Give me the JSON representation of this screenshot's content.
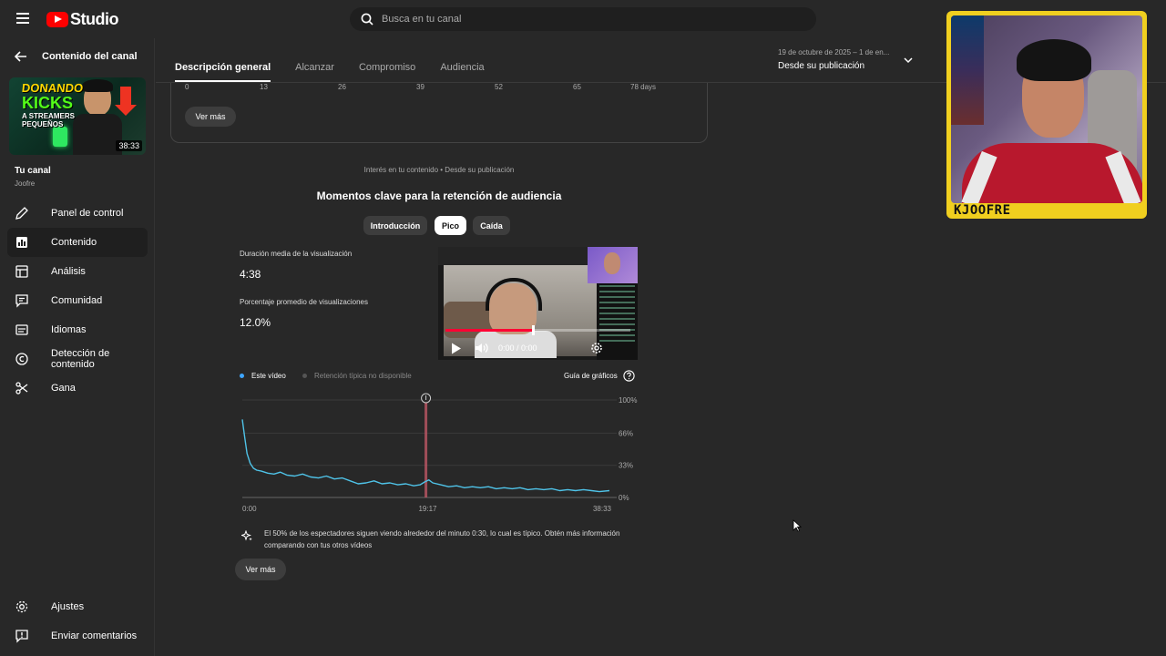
{
  "app": {
    "logo_text": "Studio",
    "search_placeholder": "Busca en tu canal"
  },
  "sidebar": {
    "back_label": "Contenido del canal",
    "video_thumb": {
      "line1": "DONANDO",
      "line2": "KICKS",
      "line3": "A STREAMERS\nPEQUEÑOS",
      "duration": "38:33"
    },
    "channel_title": "Tu canal",
    "channel_name": "Joofre",
    "items": [
      {
        "label": "Panel de control",
        "icon": "pencil-icon"
      },
      {
        "label": "Contenido",
        "icon": "content-icon"
      },
      {
        "label": "Análisis",
        "icon": "analytics-icon"
      },
      {
        "label": "Comunidad",
        "icon": "comment-icon"
      },
      {
        "label": "Idiomas",
        "icon": "subtitles-icon"
      },
      {
        "label": "Detección de contenido",
        "icon": "copyright-icon"
      },
      {
        "label": "Gana",
        "icon": "scissors-icon"
      }
    ],
    "bottom_items": [
      {
        "label": "Ajustes",
        "icon": "gear-icon"
      },
      {
        "label": "Enviar comentarios",
        "icon": "feedback-icon"
      }
    ]
  },
  "tabs": [
    {
      "label": "Descripción general"
    },
    {
      "label": "Alcanzar"
    },
    {
      "label": "Compromiso"
    },
    {
      "label": "Audiencia"
    }
  ],
  "date_range": {
    "range": "19 de octubre de 2025 – 1 de en...",
    "label": "Desde su publicación"
  },
  "top_card": {
    "x_ticks": [
      "0",
      "13",
      "26",
      "39",
      "52",
      "65",
      "78 days"
    ],
    "more_button": "Ver más"
  },
  "retention": {
    "caption": "Interés en tu contenido • Desde su publicación",
    "title": "Momentos clave para la retención de audiencia",
    "chips": [
      "Introducción",
      "Pico",
      "Caída"
    ],
    "avg_duration_label": "Duración media de la visualización",
    "avg_duration_value": "4:38",
    "avg_percent_label": "Porcentaje promedio de visualizaciones",
    "avg_percent_value": "12.0%",
    "player_time": "0:00 / 0:00",
    "legend_this": "Este vídeo",
    "legend_typical": "Retención típica no disponible",
    "guide_label": "Guía de gráficos",
    "insight": "El 50% de los espectadores siguen viendo alrededor del minuto 0:30, lo cual es típico. Obtén más información comparando con tus otros vídeos",
    "more_button": "Ver más"
  },
  "webcam": {
    "label": "KJOOFRE"
  },
  "colors": {
    "accent_line": "#4fc3e8",
    "marker": "#c85a6a",
    "legend_this": "#3ea6ff",
    "legend_typical": "#555555",
    "frame": "#f0cf1f"
  },
  "chart_data": {
    "type": "line",
    "x_ticks": [
      "0:00",
      "19:17",
      "38:33"
    ],
    "y_ticks": [
      "100%",
      "66%",
      "33%",
      "0%"
    ],
    "ylim": [
      0,
      100
    ],
    "xlim_seconds": [
      0,
      2313
    ],
    "highlight_x_seconds": 1157,
    "series": [
      {
        "name": "Este vídeo",
        "points": [
          [
            0,
            80
          ],
          [
            15,
            62
          ],
          [
            30,
            45
          ],
          [
            50,
            35
          ],
          [
            70,
            30
          ],
          [
            90,
            28
          ],
          [
            120,
            27
          ],
          [
            160,
            25
          ],
          [
            200,
            24
          ],
          [
            240,
            26
          ],
          [
            280,
            23
          ],
          [
            330,
            22
          ],
          [
            380,
            24
          ],
          [
            430,
            21
          ],
          [
            480,
            20
          ],
          [
            530,
            22
          ],
          [
            580,
            19
          ],
          [
            630,
            20
          ],
          [
            680,
            17
          ],
          [
            730,
            14
          ],
          [
            780,
            15
          ],
          [
            830,
            17
          ],
          [
            880,
            14
          ],
          [
            930,
            15
          ],
          [
            980,
            13
          ],
          [
            1030,
            14
          ],
          [
            1080,
            12
          ],
          [
            1120,
            13
          ],
          [
            1150,
            16
          ],
          [
            1175,
            18
          ],
          [
            1200,
            15
          ],
          [
            1250,
            13
          ],
          [
            1300,
            11
          ],
          [
            1350,
            12
          ],
          [
            1400,
            10
          ],
          [
            1450,
            11
          ],
          [
            1500,
            10
          ],
          [
            1550,
            11
          ],
          [
            1600,
            9
          ],
          [
            1650,
            10
          ],
          [
            1700,
            9
          ],
          [
            1750,
            10
          ],
          [
            1800,
            8
          ],
          [
            1850,
            9
          ],
          [
            1900,
            8
          ],
          [
            1950,
            9
          ],
          [
            2000,
            7
          ],
          [
            2050,
            8
          ],
          [
            2100,
            7
          ],
          [
            2150,
            8
          ],
          [
            2200,
            7
          ],
          [
            2250,
            6
          ],
          [
            2313,
            7
          ]
        ]
      }
    ]
  }
}
